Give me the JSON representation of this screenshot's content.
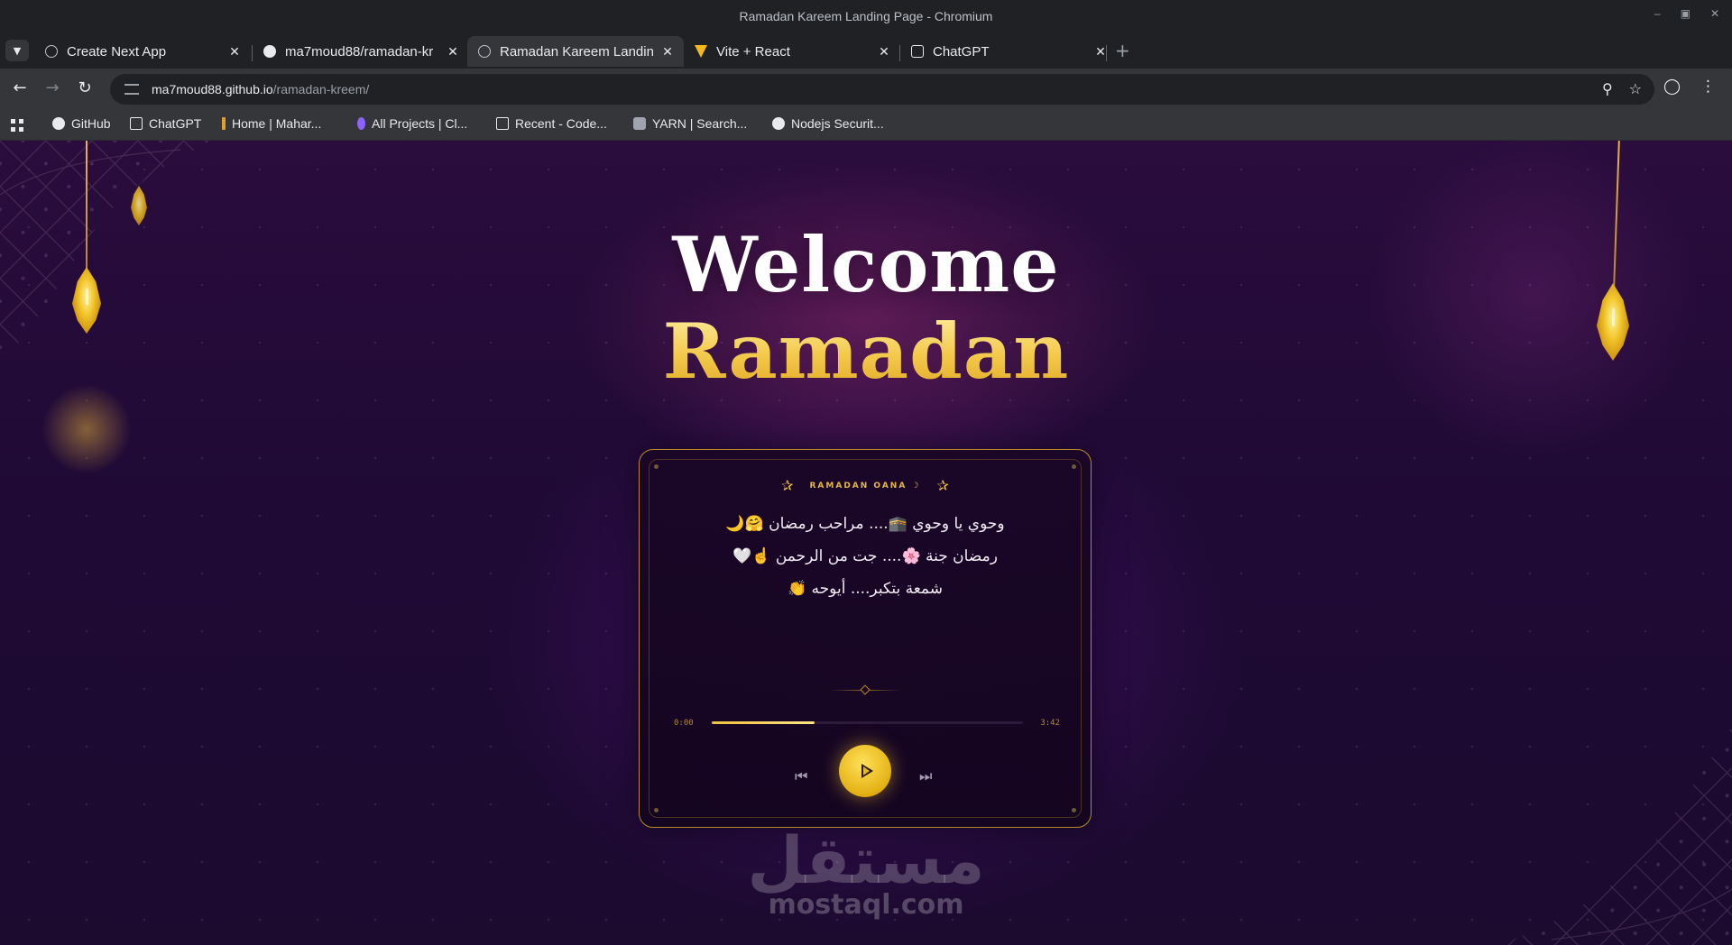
{
  "window": {
    "title": "Ramadan Kareem Landing Page - Chromium"
  },
  "tabs": [
    {
      "label": "Create Next App",
      "favicon": "globe-icon"
    },
    {
      "label": "ma7moud88/ramadan-kr",
      "favicon": "github-icon"
    },
    {
      "label": "Ramadan Kareem Landin",
      "favicon": "globe-icon",
      "active": true
    },
    {
      "label": "Vite + React",
      "favicon": "vite-icon"
    },
    {
      "label": "ChatGPT",
      "favicon": "chatgpt-icon"
    }
  ],
  "address": {
    "host": "ma7moud88.github.io",
    "path": "/ramadan-kreem/"
  },
  "bookmarks": [
    {
      "label": "GitHub"
    },
    {
      "label": "ChatGPT"
    },
    {
      "label": "Home | Mahar..."
    },
    {
      "label": "All Projects | Cl..."
    },
    {
      "label": "Recent - Code..."
    },
    {
      "label": "YARN | Search..."
    },
    {
      "label": "Nodejs Securit..."
    }
  ],
  "hero": {
    "line1": "Welcome",
    "line2": "Ramadan"
  },
  "player": {
    "station": "RAMADAN OANA ☽",
    "lyrics": [
      "وحوي يا وحوي 🕋.... مراحب رمضان 🤗🌙",
      "رمضان جنة 🌸.... جت من الرحمن ☝️🤍",
      "شمعة بتكبر.... أيوحه 👏"
    ],
    "current_time": "0:00",
    "duration": "3:42",
    "progress": 0.33
  },
  "watermark": {
    "ar": "مستقل",
    "en": "mostaql.com"
  },
  "colors": {
    "accent_gold": "#f2c23a",
    "page_bg": "#1e0a34"
  }
}
